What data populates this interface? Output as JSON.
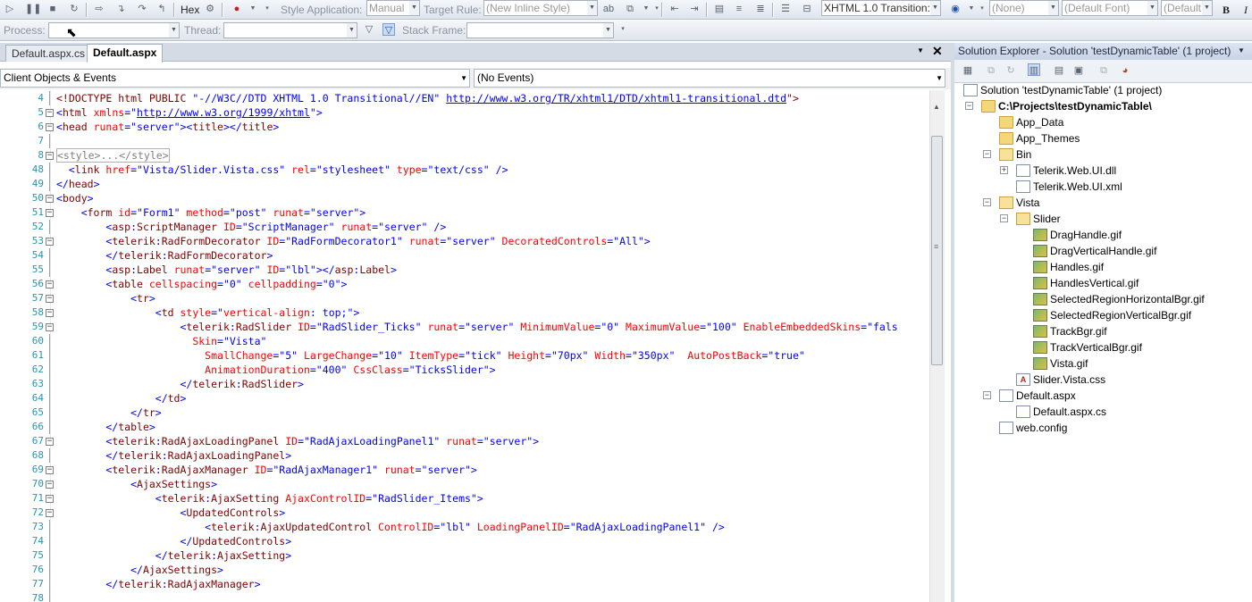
{
  "toolbar1": {
    "hex_label": "Hex",
    "style_application_label": "Style Application:",
    "style_application_value": "Manual",
    "target_rule_label": "Target Rule:",
    "target_rule_value": "(New Inline Style)",
    "doctype_value": "XHTML 1.0 Transition:",
    "class_value": "(None)",
    "font_value": "(Default Font)",
    "size_value": "(Default",
    "bold_label": "B",
    "italic_label": "I"
  },
  "toolbar2": {
    "process_label": "Process:",
    "process_value": "",
    "thread_label": "Thread:",
    "thread_value": "",
    "stack_frame_label": "Stack Frame:",
    "stack_frame_value": ""
  },
  "tabs": [
    {
      "label": "Default.aspx.cs"
    },
    {
      "label": "Default.aspx"
    }
  ],
  "dropdowns": {
    "objects": "Client Objects & Events",
    "events": "(No Events)"
  },
  "code_lines": [
    {
      "n": "4"
    },
    {
      "n": "5"
    },
    {
      "n": "6"
    },
    {
      "n": "7"
    },
    {
      "n": "8"
    },
    {
      "n": "48"
    },
    {
      "n": "49"
    },
    {
      "n": "50"
    },
    {
      "n": "51"
    },
    {
      "n": "52"
    },
    {
      "n": "53"
    },
    {
      "n": "54"
    },
    {
      "n": "55"
    },
    {
      "n": "56"
    },
    {
      "n": "57"
    },
    {
      "n": "58"
    },
    {
      "n": "59"
    },
    {
      "n": "60"
    },
    {
      "n": "61"
    },
    {
      "n": "62"
    },
    {
      "n": "63"
    },
    {
      "n": "64"
    },
    {
      "n": "65"
    },
    {
      "n": "66"
    },
    {
      "n": "67"
    },
    {
      "n": "68"
    },
    {
      "n": "69"
    },
    {
      "n": "70"
    },
    {
      "n": "71"
    },
    {
      "n": "72"
    },
    {
      "n": "73"
    },
    {
      "n": "74"
    },
    {
      "n": "75"
    },
    {
      "n": "76"
    },
    {
      "n": "77"
    },
    {
      "n": "78"
    }
  ],
  "solution_explorer": {
    "title": "Solution Explorer - Solution 'testDynamicTable' (1 project)",
    "nodes": [
      {
        "label": "Solution 'testDynamicTable' (1 project)"
      },
      {
        "label": "C:\\Projects\\testDynamicTable\\"
      },
      {
        "label": "App_Data"
      },
      {
        "label": "App_Themes"
      },
      {
        "label": "Bin"
      },
      {
        "label": "Telerik.Web.UI.dll"
      },
      {
        "label": "Telerik.Web.UI.xml"
      },
      {
        "label": "Vista"
      },
      {
        "label": "Slider"
      },
      {
        "label": "DragHandle.gif"
      },
      {
        "label": "DragVerticalHandle.gif"
      },
      {
        "label": "Handles.gif"
      },
      {
        "label": "HandlesVertical.gif"
      },
      {
        "label": "SelectedRegionHorizontalBgr.gif"
      },
      {
        "label": "SelectedRegionVerticalBgr.gif"
      },
      {
        "label": "TrackBgr.gif"
      },
      {
        "label": "TrackVerticalBgr.gif"
      },
      {
        "label": "Vista.gif"
      },
      {
        "label": "Slider.Vista.css"
      },
      {
        "label": "Default.aspx"
      },
      {
        "label": "Default.aspx.cs"
      },
      {
        "label": "web.config"
      }
    ]
  },
  "code": {
    "l4": [
      "<!DOCTYPE html PUBLIC ",
      "\"-//W3C//DTD XHTML 1.0 Transitional//EN\"",
      " ",
      "http://www.w3.org/TR/xhtml1/DTD/xhtml1-transitional.dtd",
      "\">"
    ],
    "l5": [
      "<",
      "html",
      " xmlns",
      "=\"",
      "http://www.w3.org/1999/xhtml",
      "\">"
    ],
    "l6": [
      "<",
      "head",
      " runat",
      "=\"server\"><",
      "title",
      "></",
      "title",
      ">"
    ],
    "l8": "<style>...</style>",
    "l48": [
      "  <",
      "link",
      " href",
      "=\"Vista/Slider.Vista.css\"",
      " rel",
      "=\"stylesheet\"",
      " type",
      "=\"text/css\"",
      " />"
    ],
    "l49": [
      "</",
      "head",
      ">"
    ],
    "l50": [
      "<",
      "body",
      ">"
    ],
    "l51": [
      "    <",
      "form",
      " id",
      "=\"Form1\"",
      " method",
      "=\"post\"",
      " runat",
      "=\"server\"",
      ">"
    ],
    "l52": [
      "        <",
      "asp",
      ":",
      "ScriptManager",
      " ID",
      "=\"ScriptManager\"",
      " runat",
      "=\"server\"",
      " />"
    ],
    "l53": [
      "        <",
      "telerik",
      ":",
      "RadFormDecorator",
      " ID",
      "=\"RadFormDecorator1\"",
      " runat",
      "=\"server\"",
      " DecoratedControls",
      "=\"All\"",
      ">"
    ],
    "l54": [
      "        </",
      "telerik",
      ":",
      "RadFormDecorator",
      ">"
    ],
    "l55": [
      "        <",
      "asp",
      ":",
      "Label",
      " runat",
      "=\"server\"",
      " ID",
      "=\"lbl\"",
      "></",
      "asp",
      ":",
      "Label",
      ">"
    ],
    "l56": [
      "        <",
      "table",
      " cellspacing",
      "=\"0\"",
      " cellpadding",
      "=\"0\"",
      ">"
    ],
    "l57": [
      "            <",
      "tr",
      ">"
    ],
    "l58": [
      "                <",
      "td",
      " style",
      "=\"",
      "vertical-align",
      ": ",
      "top",
      ";\">"
    ],
    "l59": [
      "                    <",
      "telerik",
      ":",
      "RadSlider",
      " ID",
      "=\"RadSlider_Ticks\"",
      " runat",
      "=\"server\"",
      " MinimumValue",
      "=\"0\"",
      " MaximumValue",
      "=\"100\"",
      " EnableEmbeddedSkins",
      "=\"fals"
    ],
    "l60": [
      "                      ",
      "Skin",
      "=\"Vista\""
    ],
    "l61": [
      "                        ",
      "SmallChange",
      "=\"5\"",
      " LargeChange",
      "=\"10\"",
      " ItemType",
      "=\"tick\"",
      " Height",
      "=\"70px\"",
      " Width",
      "=\"350px\"",
      "  AutoPostBack",
      "=\"true\""
    ],
    "l62": [
      "                        ",
      "AnimationDuration",
      "=\"400\"",
      " CssClass",
      "=\"TicksSlider\"",
      ">"
    ],
    "l63": [
      "                    </",
      "telerik",
      ":",
      "RadSlider",
      ">"
    ],
    "l64": [
      "                </",
      "td",
      ">"
    ],
    "l65": [
      "            </",
      "tr",
      ">"
    ],
    "l66": [
      "        </",
      "table",
      ">"
    ],
    "l67": [
      "        <",
      "telerik",
      ":",
      "RadAjaxLoadingPanel",
      " ID",
      "=\"RadAjaxLoadingPanel1\"",
      " runat",
      "=\"server\"",
      ">"
    ],
    "l68": [
      "        </",
      "telerik",
      ":",
      "RadAjaxLoadingPanel",
      ">"
    ],
    "l69": [
      "        <",
      "telerik",
      ":",
      "RadAjaxManager",
      " ID",
      "=\"RadAjaxManager1\"",
      " runat",
      "=\"server\"",
      ">"
    ],
    "l70": [
      "            <",
      "AjaxSettings",
      ">"
    ],
    "l71": [
      "                <",
      "telerik",
      ":",
      "AjaxSetting",
      " AjaxControlID",
      "=\"RadSlider_Items\"",
      ">"
    ],
    "l72": [
      "                    <",
      "UpdatedControls",
      ">"
    ],
    "l73": [
      "                        <",
      "telerik",
      ":",
      "AjaxUpdatedControl",
      " ControlID",
      "=\"lbl\"",
      " LoadingPanelID",
      "=\"RadAjaxLoadingPanel1\"",
      " />"
    ],
    "l74": [
      "                    </",
      "UpdatedControls",
      ">"
    ],
    "l75": [
      "                </",
      "telerik",
      ":",
      "AjaxSetting",
      ">"
    ],
    "l76": [
      "            </",
      "AjaxSettings",
      ">"
    ],
    "l77": [
      "        </",
      "telerik",
      ":",
      "RadAjaxManager",
      ">"
    ]
  }
}
